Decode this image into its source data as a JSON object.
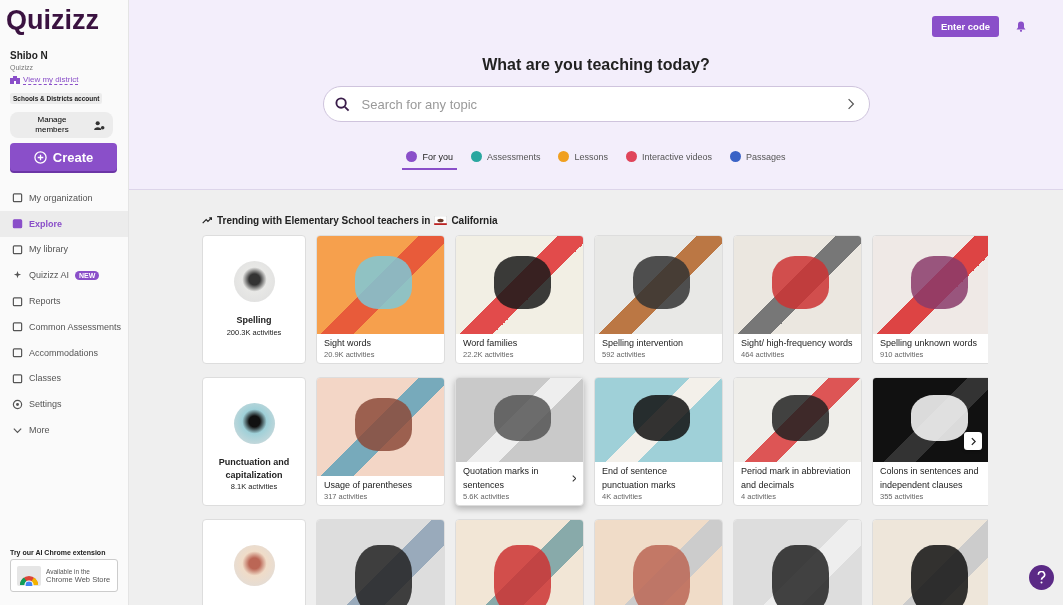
{
  "sidebar": {
    "logo": "Quizizz",
    "user": {
      "name": "Shibo N",
      "org": "Quizizz",
      "district_link": "View my district",
      "account_badge": "Schools & Districts account"
    },
    "manage_button": "Manage members",
    "create_button": "Create",
    "items": [
      {
        "label": "My organization",
        "selected": false
      },
      {
        "label": "Explore",
        "selected": true
      },
      {
        "label": "My library",
        "selected": false
      },
      {
        "label": "Quizizz AI",
        "selected": false,
        "badge": "NEW"
      },
      {
        "label": "Reports",
        "selected": false
      },
      {
        "label": "Common Assessments",
        "selected": false
      },
      {
        "label": "Accommodations",
        "selected": false
      },
      {
        "label": "Classes",
        "selected": false
      },
      {
        "label": "Settings",
        "selected": false
      },
      {
        "label": "More",
        "selected": false
      }
    ],
    "extension": {
      "title": "Try our AI Chrome extension",
      "badge_line1": "Available in the",
      "badge_line2": "Chrome Web Store"
    }
  },
  "header": {
    "enter_code_button": "Enter code",
    "title": "What are you teaching today?",
    "search": {
      "placeholder": "Search for any topic"
    },
    "tabs": [
      {
        "label": "For you",
        "selected": true
      },
      {
        "label": "Assessments",
        "selected": false
      },
      {
        "label": "Lessons",
        "selected": false
      },
      {
        "label": "Interactive videos",
        "selected": false
      },
      {
        "label": "Passages",
        "selected": false
      }
    ]
  },
  "section": {
    "title_before": "Trending with Elementary School teachers in",
    "title_place": "California"
  },
  "rows": [
    {
      "category": {
        "kind": "full",
        "title": "Spelling",
        "count": "200.3K activities"
      },
      "topics": [
        {
          "kind": "full",
          "title": "Sight words",
          "count": "20.9K activities",
          "hovered": false
        },
        {
          "kind": "full",
          "title": "Word families",
          "count": "22.2K activities",
          "hovered": false
        },
        {
          "kind": "full",
          "title": "Spelling intervention",
          "count": "592 activities",
          "hovered": false
        },
        {
          "kind": "full",
          "title": "Sight/ high-frequency words",
          "count": "464 activities",
          "hovered": false
        },
        {
          "kind": "full",
          "title": "Spelling unknown words",
          "count": "910 activities",
          "hovered": false
        }
      ]
    },
    {
      "category": {
        "kind": "full",
        "title": "Punctuation and capitalization",
        "count": "8.1K activities"
      },
      "topics": [
        {
          "kind": "full",
          "title": "Usage of parentheses",
          "count": "317 activities",
          "hovered": false
        },
        {
          "kind": "full",
          "title": "Quotation marks in sentences",
          "count": "5.6K activities",
          "hovered": true
        },
        {
          "kind": "full",
          "title": "End of sentence punctuation marks",
          "count": "4K activities",
          "hovered": false
        },
        {
          "kind": "full",
          "title": "Period mark in abbreviation and decimals",
          "count": "4 activities",
          "hovered": false
        },
        {
          "kind": "full",
          "title": "Colons in sentences and independent clauses",
          "count": "355 activities",
          "hovered": false
        }
      ]
    },
    {
      "category": {
        "kind": "image"
      },
      "topics": [
        {
          "kind": "image",
          "hovered": false
        },
        {
          "kind": "image",
          "hovered": false
        },
        {
          "kind": "image",
          "hovered": false
        },
        {
          "kind": "image",
          "hovered": false
        },
        {
          "kind": "image",
          "hovered": false
        }
      ]
    }
  ]
}
